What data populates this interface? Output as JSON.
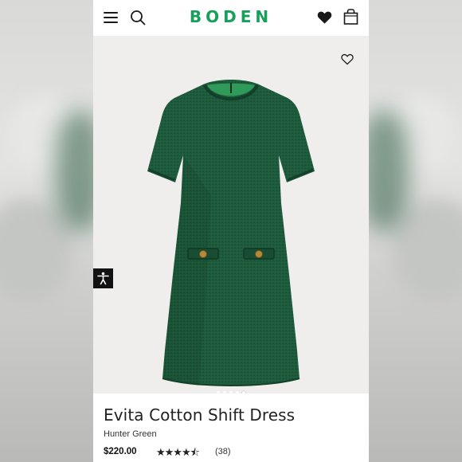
{
  "header": {
    "brand": "BODEN",
    "menu_icon": "hamburger-menu-icon",
    "search_icon": "search-icon",
    "wishlist_icon": "heart-filled-icon",
    "bag_icon": "shopping-bag-icon"
  },
  "product": {
    "name": "Evita Cotton Shift Dress",
    "color": "Hunter Green",
    "price": "$220.00",
    "rating": 4.5,
    "rating_stars": "★★★★⯪",
    "review_count": "(38)",
    "image_pages": 5,
    "active_page": 5
  },
  "colors": {
    "brand_green": "#16a05a",
    "dress_green": "#1e5a3c"
  }
}
